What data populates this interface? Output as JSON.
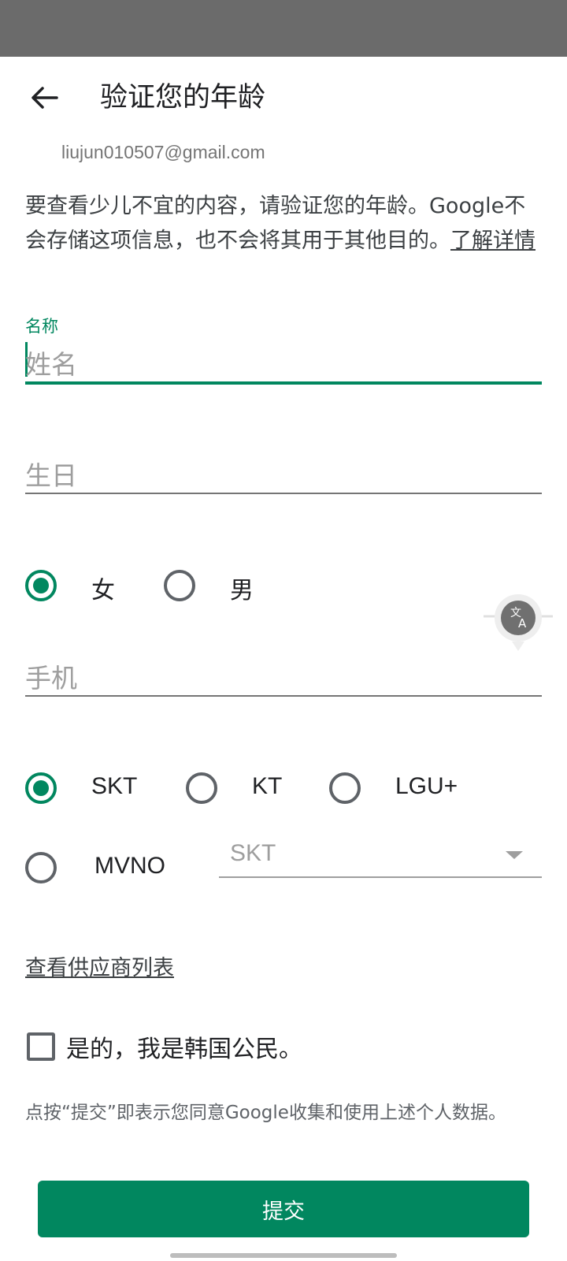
{
  "header": {
    "title": "验证您的年龄",
    "account_email": "liujun010507@gmail.com"
  },
  "description": {
    "text": "要查看少儿不宜的内容，请验证您的年龄。Google不会存储这项信息，也不会将其用于其他目的。",
    "link": "了解详情"
  },
  "form": {
    "name": {
      "label": "名称",
      "placeholder": "姓名"
    },
    "birthday": {
      "placeholder": "生日"
    },
    "gender": {
      "options": [
        "女",
        "男"
      ],
      "selected": "女"
    },
    "phone": {
      "placeholder": "手机"
    },
    "carrier": {
      "options": [
        "SKT",
        "KT",
        "LGU+",
        "MVNO"
      ],
      "selected": "SKT",
      "mvno_select_value": "SKT"
    },
    "provider_link": "查看供应商列表",
    "citizen_checkbox": {
      "label": "是的，我是韩国公民。",
      "checked": false
    },
    "consent_text": "点按“提交”即表示您同意Google收集和使用上述个人数据。",
    "submit_label": "提交"
  },
  "icons": {
    "back": "arrow-left-icon",
    "translate": "translate-icon",
    "dropdown": "triangle-down-icon"
  },
  "colors": {
    "accent": "#01875f",
    "status_bar": "#6b6b6b",
    "placeholder": "#9e9e9e"
  }
}
